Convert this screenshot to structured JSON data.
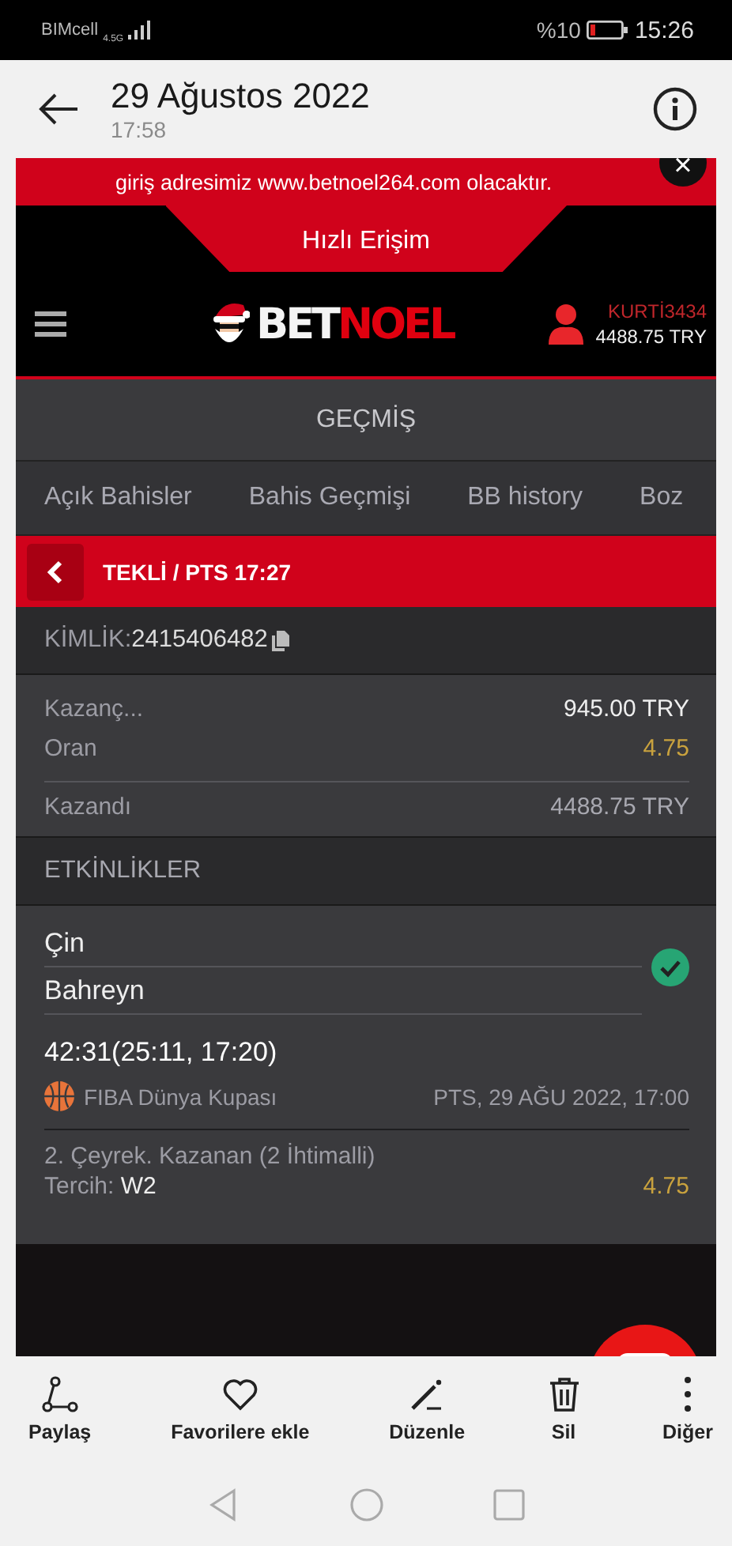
{
  "status_bar": {
    "carrier": "BIMcell",
    "network": "4.5G",
    "battery": "%10",
    "time": "15:26"
  },
  "header": {
    "title": "29 Ağustos 2022",
    "subtitle": "17:58"
  },
  "site": {
    "banner": "giriş adresimiz www.betnoel264.com olacaktır.",
    "banner_close": "×",
    "quick_access": "Hızlı Erişim",
    "logo_parts": [
      {
        "text": "BET",
        "color": "#f4f4f4"
      },
      {
        "text": "NOEL",
        "color": "#e0000f"
      }
    ],
    "username": "KURTİ3434",
    "balance": "4488.75 TRY",
    "section_title": "GEÇMİŞ",
    "tabs": [
      {
        "label": "Açık Bahisler"
      },
      {
        "label": "Bahis Geçmişi"
      },
      {
        "label": "BB history"
      },
      {
        "label": "Boz"
      }
    ],
    "bet_title": "TEKLİ / PTS 17:27",
    "id_label": "KİMLİK:",
    "id_value": "2415406482",
    "summary": [
      {
        "label": "Kazanç...",
        "value": "945.00 TRY",
        "kind": "stake"
      },
      {
        "label": "Oran",
        "value": "4.75",
        "kind": "odds"
      },
      {
        "label": "Kazandı",
        "value": "4488.75 TRY",
        "kind": "payout"
      }
    ],
    "events_title": "ETKİNLİKLER",
    "event": {
      "teams": [
        "Çin",
        "Bahreyn"
      ],
      "won": true,
      "score": "42:31(25:11, 17:20)",
      "league": "FIBA Dünya Kupası",
      "date": "PTS, 29 AĞU 2022, 17:00",
      "market": "2. Çeyrek. Kazanan (2 İhtimalli)",
      "choice_label": "Tercih:",
      "choice": "W2",
      "odds": "4.75"
    }
  },
  "toolbar": [
    {
      "label": "Paylaş",
      "kind": "share"
    },
    {
      "label": "Favorilere ekle",
      "kind": "favorite"
    },
    {
      "label": "Düzenle",
      "kind": "edit"
    },
    {
      "label": "Sil",
      "kind": "delete"
    },
    {
      "label": "Diğer",
      "kind": "more"
    }
  ]
}
